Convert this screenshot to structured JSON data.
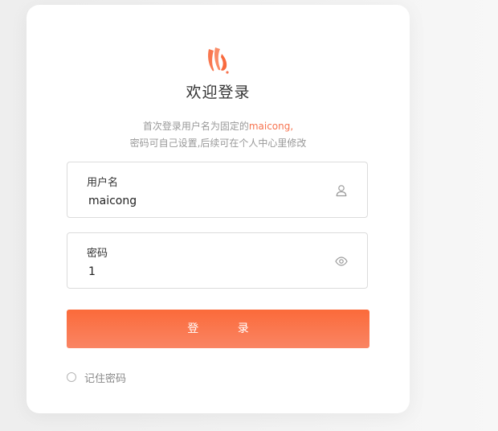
{
  "login": {
    "title": "欢迎登录",
    "tip_line1_prefix": "首次登录用户名为固定的",
    "tip_line1_highlight": "maicong,",
    "tip_line2": "密码可自己设置,后续可在个人中心里修改",
    "username_label": "用户名",
    "username_value": "maicong",
    "password_label": "密码",
    "password_value": "1",
    "login_button": "登 录",
    "remember_label": "记住密码"
  },
  "icons": {
    "logo": "flame-logo-icon",
    "username": "user-icon",
    "password": "eye-icon"
  },
  "colors": {
    "accent": "#f77450",
    "button_top": "#fb6a3a",
    "button_bottom": "#fa8564"
  }
}
